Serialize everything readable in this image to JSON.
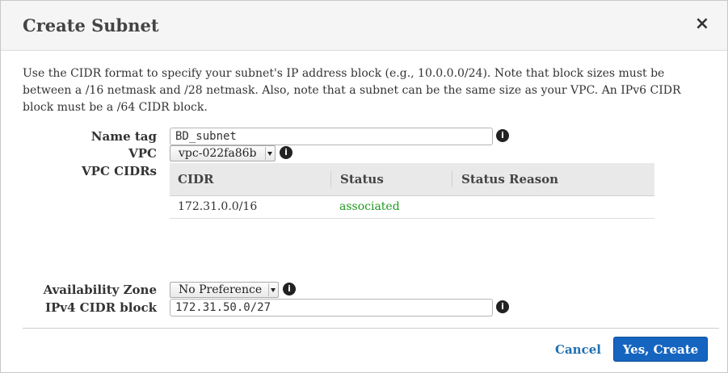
{
  "dialog": {
    "title": "Create Subnet",
    "close_glyph": "×",
    "description": "Use the CIDR format to specify your subnet's IP address block (e.g., 10.0.0.0/24). Note that block sizes must be between a /16 netmask and /28 netmask. Also, note that a subnet can be the same size as your VPC. An IPv6 CIDR block must be a /64 CIDR block."
  },
  "form": {
    "name_tag": {
      "label": "Name tag",
      "value": "BD_subnet"
    },
    "vpc": {
      "label": "VPC",
      "selected": "vpc-022fa86b"
    },
    "vpc_cidrs": {
      "label": "VPC CIDRs",
      "columns": [
        "CIDR",
        "Status",
        "Status Reason"
      ],
      "rows": [
        {
          "cidr": "172.31.0.0/16",
          "status": "associated",
          "reason": ""
        }
      ]
    },
    "availability_zone": {
      "label": "Availability Zone",
      "selected": "No Preference"
    },
    "ipv4_cidr": {
      "label": "IPv4 CIDR block",
      "value": "172.31.50.0/27"
    }
  },
  "icons": {
    "info": "info-icon",
    "close": "close-icon",
    "dropdown": "chevron-down-icon"
  },
  "colors": {
    "primary": "#1565c0",
    "link": "#1f6fb2",
    "status_ok": "#1d9a1d"
  },
  "footer": {
    "cancel_label": "Cancel",
    "create_label": "Yes, Create"
  }
}
